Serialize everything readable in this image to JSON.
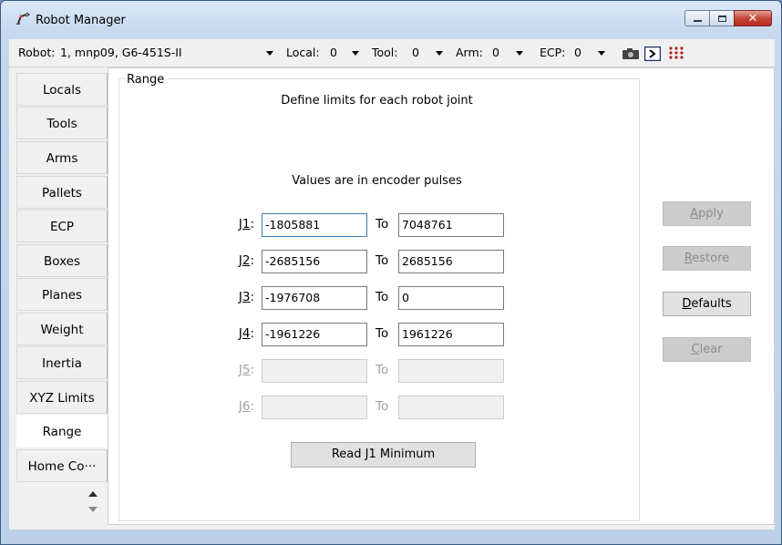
{
  "window": {
    "title": "Robot Manager"
  },
  "toolbar": {
    "robot_label": "Robot:",
    "robot_value": "1, mnp09, G6-451S-II",
    "local_label": "Local:",
    "local_value": "0",
    "tool_label": "Tool:",
    "tool_value": "0",
    "arm_label": "Arm:",
    "arm_value": "0",
    "ecp_label": "ECP:",
    "ecp_value": "0",
    "icons": [
      "camera-icon",
      "terminal-icon",
      "io-monitor-icon"
    ]
  },
  "tabs": [
    {
      "label": "Locals"
    },
    {
      "label": "Tools"
    },
    {
      "label": "Arms"
    },
    {
      "label": "Pallets"
    },
    {
      "label": "ECP"
    },
    {
      "label": "Boxes"
    },
    {
      "label": "Planes"
    },
    {
      "label": "Weight"
    },
    {
      "label": "Inertia"
    },
    {
      "label": "XYZ Limits"
    },
    {
      "label": "Range"
    },
    {
      "label": "Home Co···"
    }
  ],
  "active_tab": "Range",
  "panel": {
    "group_title": "Range",
    "description": "Define limits for each robot joint",
    "units_note": "Values are in encoder pulses",
    "to_label": "To",
    "joints": [
      {
        "hotkey": "1",
        "label_suffix": ":",
        "min": "-1805881",
        "max": "7048761",
        "enabled": true
      },
      {
        "hotkey": "2",
        "label_suffix": ":",
        "min": "-2685156",
        "max": "2685156",
        "enabled": true
      },
      {
        "hotkey": "3",
        "label_suffix": ":",
        "min": "-1976708",
        "max": "0",
        "enabled": true
      },
      {
        "hotkey": "4",
        "label_suffix": ":",
        "min": "-1961226",
        "max": "1961226",
        "enabled": true
      },
      {
        "hotkey": "5",
        "label_suffix": ":",
        "min": "",
        "max": "",
        "enabled": false
      },
      {
        "hotkey": "6",
        "label_suffix": ":",
        "min": "",
        "max": "",
        "enabled": false
      }
    ],
    "read_button": "Read J1 Minimum"
  },
  "side_buttons": {
    "apply": {
      "accel": "A",
      "rest": "pply",
      "enabled": false
    },
    "restore": {
      "accel": "R",
      "rest": "estore",
      "enabled": false
    },
    "defaults": {
      "accel": "D",
      "rest": "efaults",
      "enabled": true
    },
    "clear": {
      "accel": "C",
      "rest": "lear",
      "enabled": false
    }
  },
  "colors": {
    "focus_border": "#3c7fb1",
    "close_button": "#c5473a"
  }
}
